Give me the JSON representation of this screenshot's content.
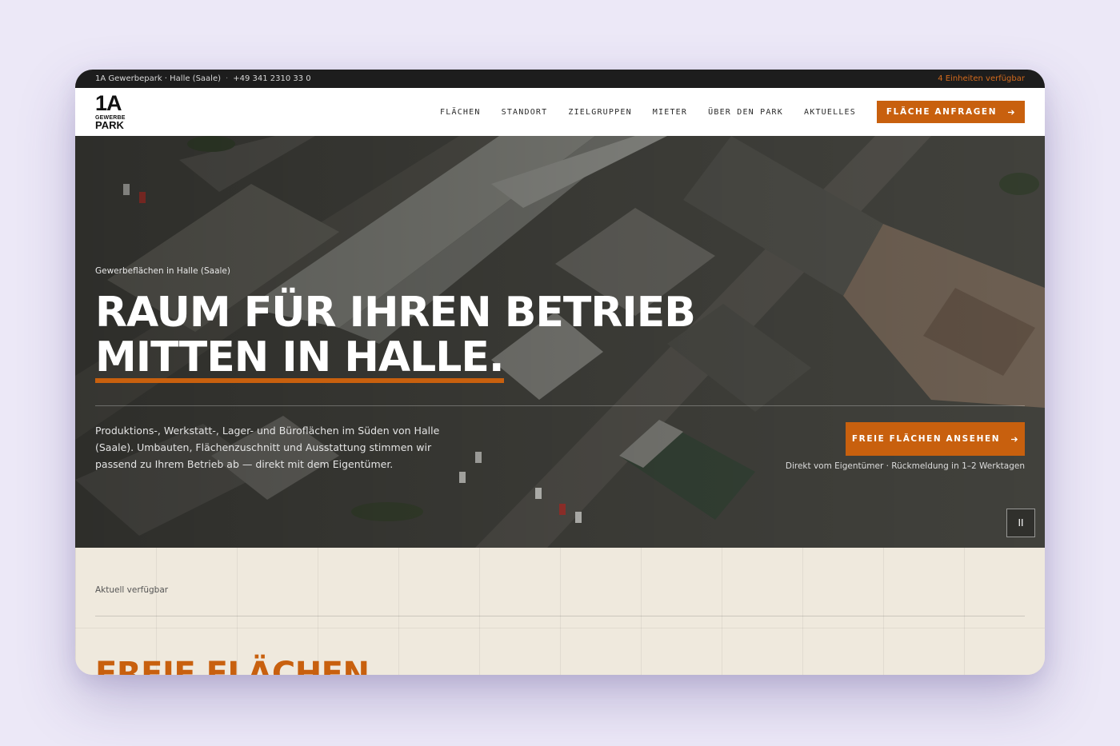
{
  "topbar": {
    "company": "1A Gewerbepark · Halle (Saale)",
    "separator": "·",
    "phone": "+49 341 2310 33 0",
    "availability": "4 Einheiten verfügbar"
  },
  "logo": {
    "line1": "1A",
    "line2": "GEWERBE",
    "line3": "PARK"
  },
  "nav": {
    "items": [
      {
        "label": "FLÄCHEN"
      },
      {
        "label": "STANDORT"
      },
      {
        "label": "ZIELGRUPPEN"
      },
      {
        "label": "MIETER"
      },
      {
        "label": "ÜBER DEN PARK"
      },
      {
        "label": "AKTUELLES"
      }
    ],
    "cta_label": "FLÄCHE ANFRAGEN",
    "cta_icon": "arrow-right-icon"
  },
  "hero": {
    "eyebrow": "Gewerbeflächen in Halle (Saale)",
    "headline_line1": "RAUM FÜR IHREN BETRIEB",
    "headline_line2": "MITTEN IN HALLE.",
    "lead": "Produktions-, Werkstatt-, Lager- und Büroflächen im Süden von Halle (Saale). Umbauten, Flächenzuschnitt und Ausstattung stimmen wir passend zu Ihrem Betrieb ab — direkt mit dem Eigentümer.",
    "cta_label": "FREIE FLÄCHEN ANSEHEN",
    "cta_icon": "arrow-right-icon",
    "note": "Direkt vom Eigentümer · Rückmeldung in 1–2 Werktagen",
    "pause_icon": "pause-icon",
    "pause_glyph": "II"
  },
  "section": {
    "label": "Aktuell verfügbar",
    "heading": "FREIE FLÄCHEN"
  },
  "colors": {
    "accent": "#c8600e",
    "topbar_bg": "#1d1d1d",
    "section_bg": "#efe9dd",
    "page_bg": "#ece8f7"
  }
}
